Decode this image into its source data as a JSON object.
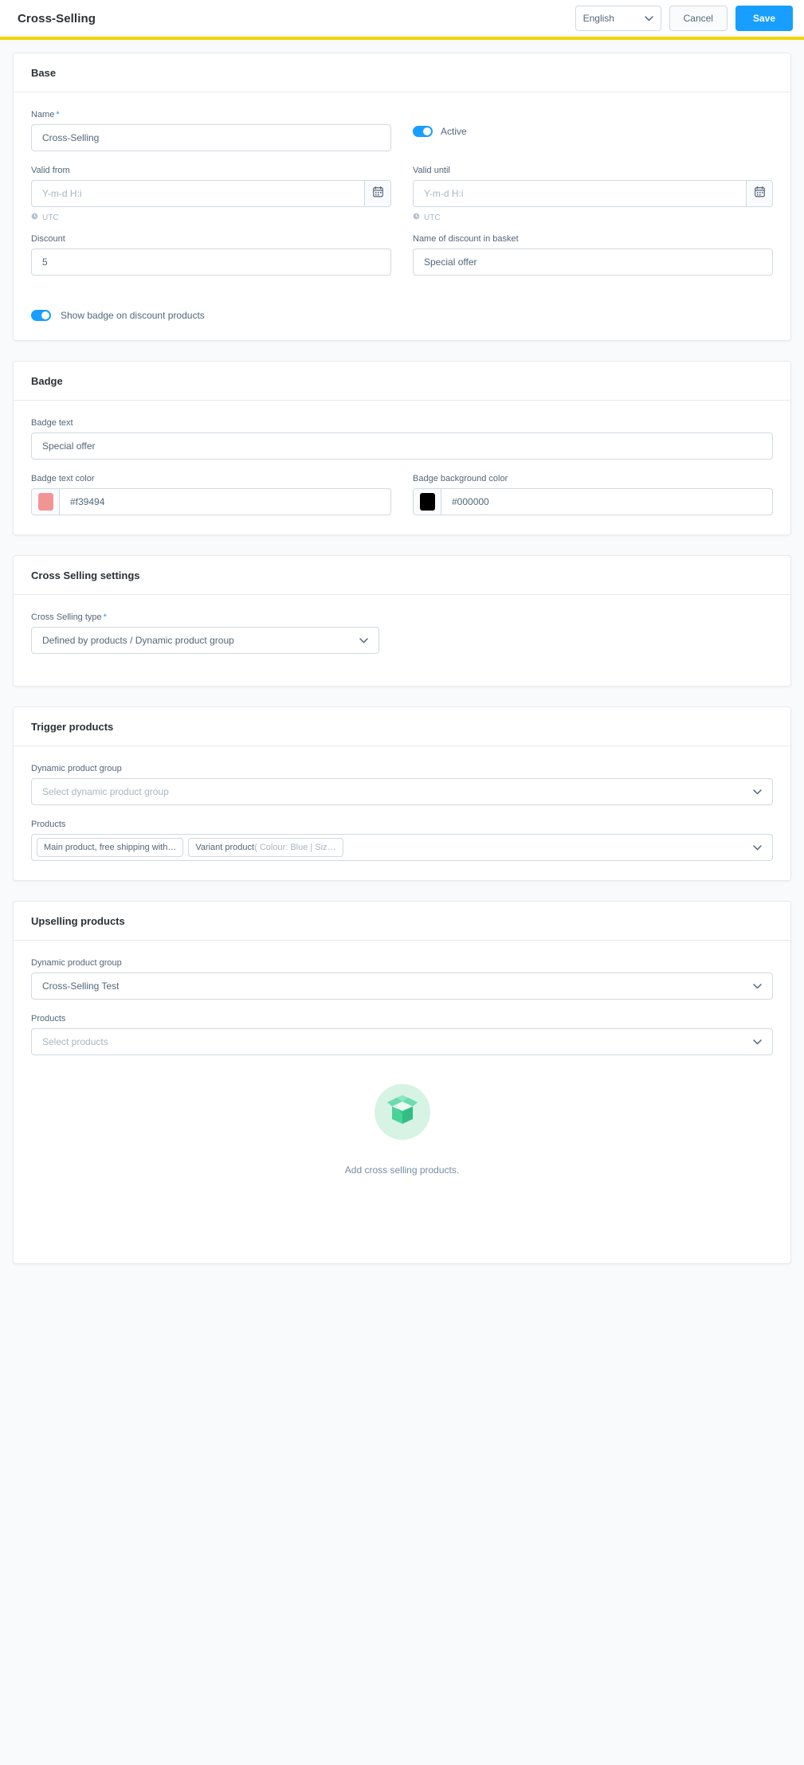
{
  "header": {
    "title": "Cross-Selling",
    "language_value": "English",
    "cancel_label": "Cancel",
    "save_label": "Save",
    "accent_color": "#189eff",
    "rule_color": "#f2d400"
  },
  "base": {
    "card_title": "Base",
    "name_label": "Name",
    "name_required": "*",
    "name_value": "Cross-Selling",
    "active_label": "Active",
    "valid_from_label": "Valid from",
    "valid_from_placeholder": "Y-m-d H:i",
    "valid_from_hint": "UTC",
    "valid_until_label": "Valid until",
    "valid_until_placeholder": "Y-m-d H:i",
    "valid_until_hint": "UTC",
    "discount_label": "Discount",
    "discount_value": "5",
    "discount_name_label": "Name of discount in basket",
    "discount_name_value": "Special offer",
    "show_badge_label": "Show badge on discount products"
  },
  "badge": {
    "card_title": "Badge",
    "badge_text_label": "Badge text",
    "badge_text_value": "Special offer",
    "text_color_label": "Badge text color",
    "text_color_value": "#f39494",
    "text_color_hex": "#f39494",
    "bg_color_label": "Badge background color",
    "bg_color_value": "#000000",
    "bg_color_hex": "#000000"
  },
  "cross_selling_settings": {
    "card_title": "Cross Selling settings",
    "type_label": "Cross Selling type",
    "type_required": "*",
    "type_value": "Defined by products / Dynamic product group"
  },
  "trigger_products": {
    "card_title": "Trigger products",
    "group_label": "Dynamic product group",
    "group_placeholder": "Select dynamic product group",
    "products_label": "Products",
    "product_chips": [
      {
        "main": "Main product, free shipping with ",
        "ellipsis": "…",
        "sub": ""
      },
      {
        "main": "Variant product ",
        "ellipsis": "",
        "sub": "( Colour: Blue | Siz…"
      }
    ]
  },
  "upselling_products": {
    "card_title": "Upselling products",
    "group_label": "Dynamic product group",
    "group_value": "Cross-Selling Test",
    "products_label": "Products",
    "products_placeholder": "Select products",
    "empty_state_text": "Add cross selling products.",
    "empty_state_circle_color": "#d6f3e3",
    "empty_state_box_color": "#3ecf8e"
  }
}
